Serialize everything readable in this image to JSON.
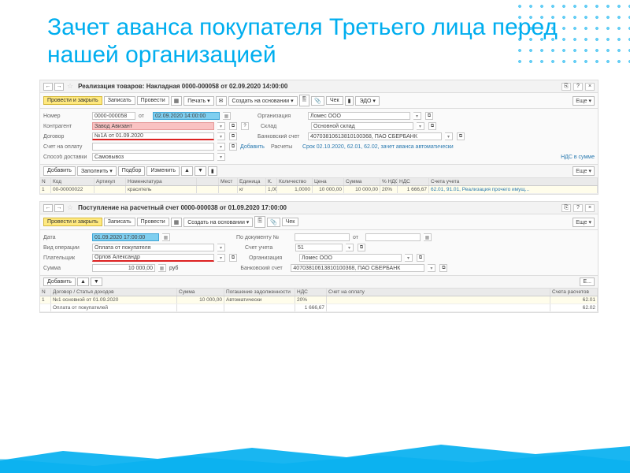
{
  "slide": {
    "title": "Зачет аванса покупателя Третьего лица перед нашей организацией"
  },
  "doc1": {
    "title": "Реализация товаров: Накладная 0000-000058 от 02.09.2020 14:00:00",
    "toolbar": {
      "post_close": "Провести и закрыть",
      "save": "Записать",
      "post": "Провести",
      "print": "Печать",
      "create_based": "Создать на основании",
      "cheque": "Чек",
      "edo": "ЭДО",
      "more": "Еще"
    },
    "fields": {
      "number_lbl": "Номер",
      "number": "0000-000058",
      "date_lbl": "от",
      "date": "02.09.2020 14:00:00",
      "org_lbl": "Организация",
      "org": "Ломес ООО",
      "counterparty_lbl": "Контрагент",
      "counterparty": "Завод Авизант",
      "warehouse_lbl": "Склад",
      "warehouse": "Основной склад",
      "contract_lbl": "Договор",
      "contract": "№1А от 01.09.2020",
      "bank_lbl": "Банковский счет",
      "bank": "40703810613810100368, ПАО СБЕРБАНК",
      "invoice_lbl": "Счет на оплату",
      "raschety_lbl": "Расчеты",
      "raschety": "Срок 02.10.2020, 62.01, 62.02, зачет аванса автоматически",
      "add_lbl": "Добавить",
      "delivery_lbl": "Способ доставки",
      "delivery": "Самовывоз",
      "nds_lbl": "НДС в сумме"
    },
    "grid_toolbar": {
      "add": "Добавить",
      "fill": "Заполнить",
      "pick": "Подбор",
      "change": "Изменить",
      "more": "Еще"
    },
    "columns": {
      "n": "N",
      "code": "Код",
      "art": "Артикул",
      "nom": "Номенклатура",
      "mest": "Мест",
      "ed": "Единица",
      "k": "К.",
      "qty": "Количество",
      "price": "Цена",
      "sum": "Сумма",
      "nds_pct": "% НДС",
      "nds": "НДС",
      "acc": "Счета учета"
    },
    "rows": [
      {
        "n": "1",
        "code": "00-00000022",
        "art": "",
        "nom": "краситель",
        "ed": "кг",
        "k": "1,000",
        "qty": "1,0000",
        "price": "10 000,00",
        "sum": "10 000,00",
        "nds_pct": "20%",
        "nds": "1 666,67",
        "acc": "62.01, 91.01, Реализация прочего имущ..."
      }
    ]
  },
  "doc2": {
    "title": "Поступление на расчетный счет 0000-000038 от 01.09.2020 17:00:00",
    "toolbar": {
      "post_close": "Провести и закрыть",
      "save": "Записать",
      "post": "Провести",
      "create_based": "Создать на основании",
      "cheque": "Чек",
      "more": "Еще"
    },
    "fields": {
      "date_lbl": "Дата",
      "date": "01.09.2020 17:00:00",
      "doc_no_lbl": "По документу №",
      "doc_no_from": "от",
      "optype_lbl": "Вид операции",
      "optype": "Оплата от покупателя",
      "acc_lbl": "Счет учета",
      "acc": "51",
      "payer_lbl": "Плательщик",
      "payer": "Орлов Александр",
      "org_lbl": "Организация",
      "org": "Ломес ООО",
      "sum_lbl": "Сумма",
      "sum": "10 000,00",
      "sum_cur": "руб",
      "bank_lbl": "Банковский счет",
      "bank": "40703810613810100368, ПАО СБЕРБАНК"
    },
    "grid_toolbar": {
      "add": "Добавить"
    },
    "columns": {
      "n": "N",
      "dog": "Договор / Статья доходов",
      "sum": "Сумма",
      "pog": "Погашение задолженности",
      "nds": "НДС",
      "scho": "Счет на оплату",
      "sr": "Счета расчетов"
    },
    "rows": [
      {
        "n": "1",
        "dog": "№1 основной от 01.09.2020",
        "sum": "10 000,00",
        "pog": "Автоматически",
        "nds": "20%",
        "scho": "",
        "sr": "62.01"
      },
      {
        "n": "",
        "dog": "Оплата от покупателей",
        "sum": "",
        "pog": "",
        "nds": "1 666,67",
        "scho": "",
        "sr": "62.02"
      }
    ]
  }
}
